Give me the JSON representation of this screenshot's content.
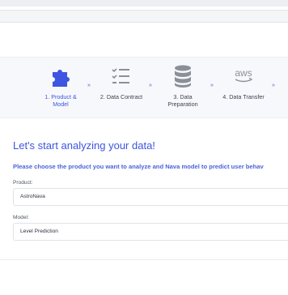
{
  "steps": [
    {
      "label": "1. Product & Model",
      "active": true,
      "icon": "puzzle-icon"
    },
    {
      "label": "2. Data Contract",
      "active": false,
      "icon": "checklist-icon"
    },
    {
      "label": "3. Data Preparation",
      "active": false,
      "icon": "database-icon"
    },
    {
      "label": "4. Data Transfer",
      "active": false,
      "icon": "aws-logo-icon"
    }
  ],
  "step_separator": "»",
  "main": {
    "heading": "Let's start analyzing your data!",
    "subheading": "Please choose the product you want to analyze and Nava model to predict user behav",
    "product": {
      "label": "Product:",
      "value": "AstroNava"
    },
    "model": {
      "label": "Model:",
      "value": "Level Prediction"
    }
  },
  "colors": {
    "accent": "#3d55e0",
    "icon_gray": "#8b8f99",
    "band_bg": "#f7f8fb"
  }
}
